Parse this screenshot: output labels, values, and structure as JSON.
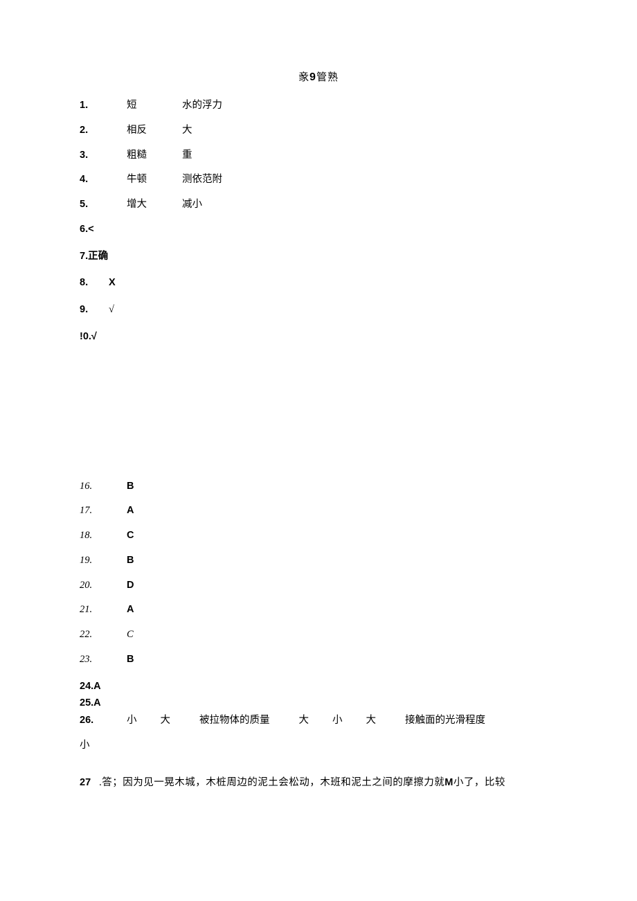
{
  "title_left": "豙",
  "title_nine": "9",
  "title_right": "管熟",
  "answers": {
    "q1": {
      "num": "1.",
      "a": "短",
      "b": "水的浮力"
    },
    "q2": {
      "num": "2.",
      "a": "相反",
      "b": "大"
    },
    "q3": {
      "num": "3.",
      "a": "粗糙",
      "b": "重"
    },
    "q4": {
      "num": "4.",
      "a": "牛顿",
      "b": "测依范附"
    },
    "q5": {
      "num": "5.",
      "a": "增大",
      "b": "减小"
    },
    "q6": {
      "num": "6.<"
    },
    "q7": {
      "num": "7.正确"
    },
    "q8": {
      "num": "8.",
      "a": "X"
    },
    "q9": {
      "num": "9.",
      "a": "√"
    },
    "q10": {
      "num": "!0.√"
    },
    "q16": {
      "num": "16.",
      "a": "B"
    },
    "q17": {
      "num": "17.",
      "a": "A"
    },
    "q18": {
      "num": "18.",
      "a": "C"
    },
    "q19": {
      "num": "19.",
      "a": "B"
    },
    "q20": {
      "num": "20.",
      "a": "D"
    },
    "q21": {
      "num": "21.",
      "a": "A"
    },
    "q22": {
      "num": "22.",
      "a": "C"
    },
    "q23": {
      "num": "23.",
      "a": "B"
    },
    "q24": {
      "num": "24.A"
    },
    "q25": {
      "num": "25.A"
    },
    "q26": {
      "num": "26.",
      "a": "小",
      "b": "大",
      "c": "被拉物体的质量",
      "d": "大",
      "e": "小",
      "f": "大",
      "g": "接触面的光滑程度",
      "h": "小"
    },
    "q27": {
      "num": "27",
      "text_before": " .答；因为见一晃木城，木桩周边的泥土会松动，木班和泥土之间的摩擦力就",
      "m": "M",
      "text_after": "小了，比较"
    }
  }
}
